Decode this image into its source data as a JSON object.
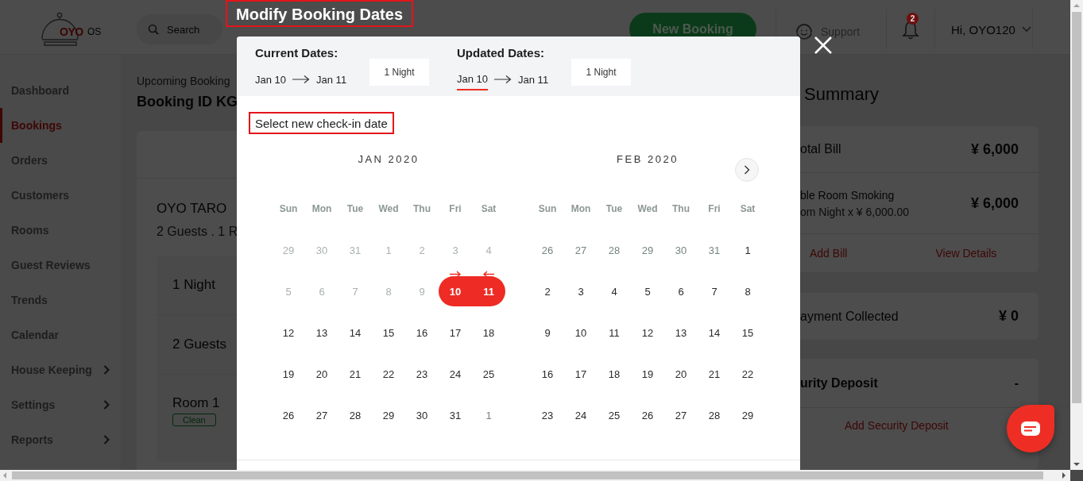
{
  "header": {
    "logo": {
      "brand": "OYO",
      "product": "OS"
    },
    "search": {
      "placeholder": "Search"
    },
    "new_booking_button": "New Booking",
    "support": "Support",
    "notifications": {
      "badge": "2"
    },
    "user_menu": "Hi, OYO120"
  },
  "sidebar": {
    "items": [
      {
        "label": "Dashboard",
        "selected": false,
        "submenu": false
      },
      {
        "label": "Bookings",
        "selected": true,
        "submenu": false
      },
      {
        "label": "Orders",
        "selected": false,
        "submenu": false
      },
      {
        "label": "Customers",
        "selected": false,
        "submenu": false
      },
      {
        "label": "Rooms",
        "selected": false,
        "submenu": false
      },
      {
        "label": "Guest Reviews",
        "selected": false,
        "submenu": false
      },
      {
        "label": "Trends",
        "selected": false,
        "submenu": false
      },
      {
        "label": "Calendar",
        "selected": false,
        "submenu": false
      },
      {
        "label": "House Keeping",
        "selected": false,
        "submenu": true
      },
      {
        "label": "Settings",
        "selected": false,
        "submenu": true
      },
      {
        "label": "Reports",
        "selected": false,
        "submenu": true
      }
    ]
  },
  "booking": {
    "breadcrumb": "Upcoming Booking",
    "booking_id": "Booking ID KG",
    "guest_name": "OYO TARO",
    "guest_summary": "2 Guests . 1 R",
    "details": [
      {
        "kind": "text",
        "label": "1 Night"
      },
      {
        "kind": "text",
        "label": "2 Guests"
      },
      {
        "kind": "room",
        "label": "Room 1",
        "status": "Clean"
      }
    ]
  },
  "summary": {
    "title": "Summary",
    "total_bill": {
      "label": "otal Bill",
      "amount": "¥ 6,000",
      "line_items": [
        {
          "name": "ble Room Smoking",
          "detail": "om Night x ¥ 6,000.00",
          "amount": "¥ 6,000"
        }
      ],
      "actions": [
        "Add Bill",
        "View Details"
      ]
    },
    "payment_collected": {
      "label": "ayment Collected",
      "amount": "¥ 0"
    },
    "security_deposit": {
      "label": "urity Deposit",
      "amount": "-",
      "action": "Add Security Deposit"
    }
  },
  "modal": {
    "title": "Modify Booking Dates",
    "current": {
      "heading": "Current Dates:",
      "from": "Jan 10",
      "to": "Jan 11",
      "nights": "1 Night",
      "from_selected": false,
      "to_selected": false
    },
    "updated": {
      "heading": "Updated Dates:",
      "from": "Jan 10",
      "to": "Jan 11",
      "nights": "1 Night",
      "from_selected": true,
      "to_selected": false
    },
    "instruction": "Select new check-in date",
    "calendars": [
      {
        "title": "JAN 2020",
        "weekdays": [
          "Sun",
          "Mon",
          "Tue",
          "Wed",
          "Thu",
          "Fri",
          "Sat"
        ],
        "weeks": [
          [
            {
              "label": "29",
              "kind": "disabled",
              "selected": false
            },
            {
              "label": "30",
              "kind": "disabled",
              "selected": false
            },
            {
              "label": "31",
              "kind": "disabled",
              "selected": false
            },
            {
              "label": "1",
              "kind": "disabled",
              "selected": false
            },
            {
              "label": "2",
              "kind": "disabled",
              "selected": false
            },
            {
              "label": "3",
              "kind": "disabled",
              "selected": false
            },
            {
              "label": "4",
              "kind": "disabled",
              "selected": false
            }
          ],
          [
            {
              "label": "5",
              "kind": "disabled",
              "selected": false
            },
            {
              "label": "6",
              "kind": "disabled",
              "selected": false
            },
            {
              "label": "7",
              "kind": "disabled",
              "selected": false
            },
            {
              "label": "8",
              "kind": "disabled",
              "selected": false
            },
            {
              "label": "9",
              "kind": "disabled",
              "selected": false
            },
            {
              "label": "10",
              "kind": "check_in",
              "selected": true
            },
            {
              "label": "11",
              "kind": "check_out",
              "selected": true
            }
          ],
          [
            {
              "label": "12",
              "kind": "day",
              "selected": false
            },
            {
              "label": "13",
              "kind": "day",
              "selected": false
            },
            {
              "label": "14",
              "kind": "day",
              "selected": false
            },
            {
              "label": "15",
              "kind": "day",
              "selected": false
            },
            {
              "label": "16",
              "kind": "day",
              "selected": false
            },
            {
              "label": "17",
              "kind": "day",
              "selected": false
            },
            {
              "label": "18",
              "kind": "day",
              "selected": false
            }
          ],
          [
            {
              "label": "19",
              "kind": "day",
              "selected": false
            },
            {
              "label": "20",
              "kind": "day",
              "selected": false
            },
            {
              "label": "21",
              "kind": "day",
              "selected": false
            },
            {
              "label": "22",
              "kind": "day",
              "selected": false
            },
            {
              "label": "23",
              "kind": "day",
              "selected": false
            },
            {
              "label": "24",
              "kind": "day",
              "selected": false
            },
            {
              "label": "25",
              "kind": "day",
              "selected": false
            }
          ],
          [
            {
              "label": "26",
              "kind": "day",
              "selected": false
            },
            {
              "label": "27",
              "kind": "day",
              "selected": false
            },
            {
              "label": "28",
              "kind": "day",
              "selected": false
            },
            {
              "label": "29",
              "kind": "day",
              "selected": false
            },
            {
              "label": "30",
              "kind": "day",
              "selected": false
            },
            {
              "label": "31",
              "kind": "day",
              "selected": false
            },
            {
              "label": "1",
              "kind": "adjacent",
              "selected": false
            }
          ]
        ]
      },
      {
        "title": "FEB 2020",
        "weekdays": [
          "Sun",
          "Mon",
          "Tue",
          "Wed",
          "Thu",
          "Fri",
          "Sat"
        ],
        "weeks": [
          [
            {
              "label": "26",
              "kind": "adjacent",
              "selected": false
            },
            {
              "label": "27",
              "kind": "adjacent",
              "selected": false
            },
            {
              "label": "28",
              "kind": "adjacent",
              "selected": false
            },
            {
              "label": "29",
              "kind": "adjacent",
              "selected": false
            },
            {
              "label": "30",
              "kind": "adjacent",
              "selected": false
            },
            {
              "label": "31",
              "kind": "adjacent",
              "selected": false
            },
            {
              "label": "1",
              "kind": "day",
              "selected": false
            }
          ],
          [
            {
              "label": "2",
              "kind": "day",
              "selected": false
            },
            {
              "label": "3",
              "kind": "day",
              "selected": false
            },
            {
              "label": "4",
              "kind": "day",
              "selected": false
            },
            {
              "label": "5",
              "kind": "day",
              "selected": false
            },
            {
              "label": "6",
              "kind": "day",
              "selected": false
            },
            {
              "label": "7",
              "kind": "day",
              "selected": false
            },
            {
              "label": "8",
              "kind": "day",
              "selected": false
            }
          ],
          [
            {
              "label": "9",
              "kind": "day",
              "selected": false
            },
            {
              "label": "10",
              "kind": "day",
              "selected": false
            },
            {
              "label": "11",
              "kind": "day",
              "selected": false
            },
            {
              "label": "12",
              "kind": "day",
              "selected": false
            },
            {
              "label": "13",
              "kind": "day",
              "selected": false
            },
            {
              "label": "14",
              "kind": "day",
              "selected": false
            },
            {
              "label": "15",
              "kind": "day",
              "selected": false
            }
          ],
          [
            {
              "label": "16",
              "kind": "day",
              "selected": false
            },
            {
              "label": "17",
              "kind": "day",
              "selected": false
            },
            {
              "label": "18",
              "kind": "day",
              "selected": false
            },
            {
              "label": "19",
              "kind": "day",
              "selected": false
            },
            {
              "label": "20",
              "kind": "day",
              "selected": false
            },
            {
              "label": "21",
              "kind": "day",
              "selected": false
            },
            {
              "label": "22",
              "kind": "day",
              "selected": false
            }
          ],
          [
            {
              "label": "23",
              "kind": "day",
              "selected": false
            },
            {
              "label": "24",
              "kind": "day",
              "selected": false
            },
            {
              "label": "25",
              "kind": "day",
              "selected": false
            },
            {
              "label": "26",
              "kind": "day",
              "selected": false
            },
            {
              "label": "27",
              "kind": "day",
              "selected": false
            },
            {
              "label": "28",
              "kind": "day",
              "selected": false
            },
            {
              "label": "29",
              "kind": "day",
              "selected": false
            }
          ]
        ]
      }
    ]
  }
}
